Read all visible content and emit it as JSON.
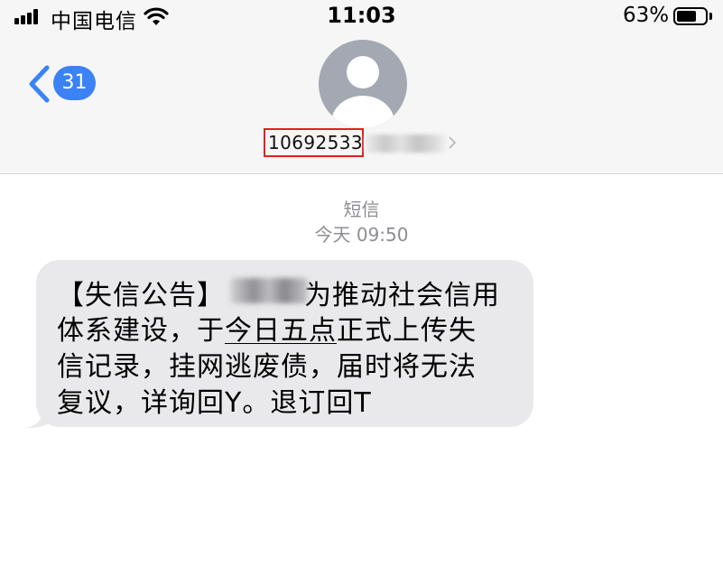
{
  "status_bar": {
    "carrier": "中国电信",
    "time": "11:03",
    "battery_percent": "63%"
  },
  "header": {
    "back_count": "31",
    "contact_number": "10692533"
  },
  "conversation": {
    "message_type": "短信",
    "timestamp": "今天 09:50",
    "message": {
      "part1": "【失信公告】",
      "part2": "为推动社会信用",
      "line2_a": "体系建设，于",
      "line2_link": "今日五点",
      "line2_b": "正式上传失",
      "line3": "信记录，挂网逃废债，届时将无法",
      "line4": "复议，详询回Y。退订回T"
    }
  },
  "icons": [
    "signal-icon",
    "wifi-icon",
    "battery-icon",
    "back-chevron-icon",
    "avatar-icon",
    "chevron-right-icon"
  ],
  "colors": {
    "accent": "#3a82f6",
    "highlight_border": "#e41f1f",
    "bubble": "#e9e9eb",
    "meta_text": "#8e8e93"
  }
}
